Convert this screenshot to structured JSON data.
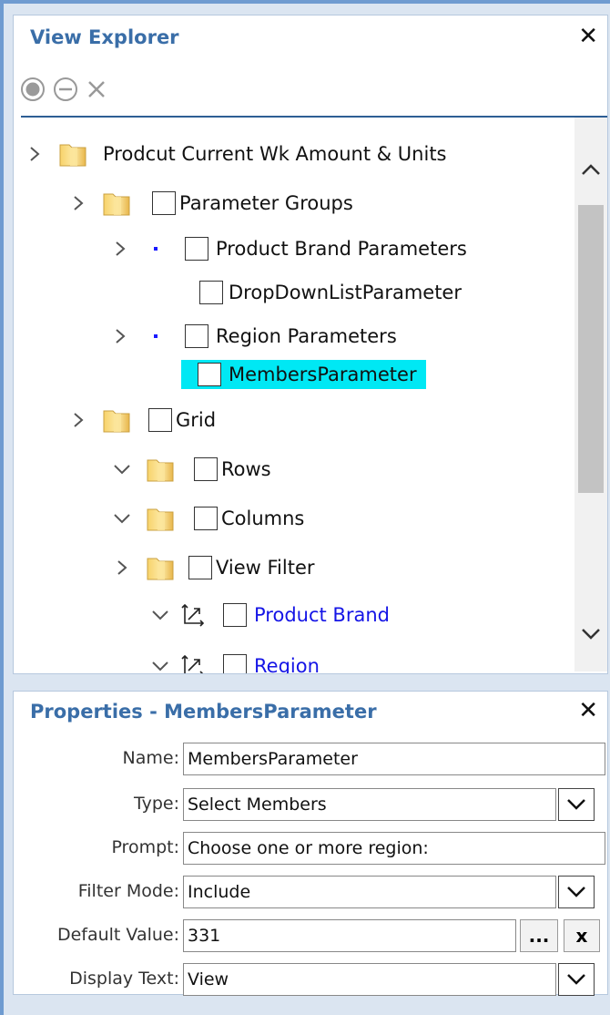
{
  "explorer": {
    "title": "View Explorer",
    "close_icon": "✕"
  },
  "tree": {
    "root": "Prodcut Current Wk Amount & Units",
    "parameter_groups": "Parameter Groups",
    "product_brand_parameters": "Product Brand Parameters",
    "dropdown_list_parameter": "DropDownListParameter",
    "region_parameters": "Region Parameters",
    "members_parameter": "MembersParameter",
    "grid": "Grid",
    "rows": "Rows",
    "columns": "Columns",
    "view_filter": "View Filter",
    "product_brand": "Product Brand",
    "region": "Region"
  },
  "properties": {
    "title": "Properties - MembersParameter",
    "close_icon": "✕",
    "name_label": "Name:",
    "name_value": "MembersParameter",
    "type_label": "Type:",
    "type_value": "Select Members",
    "prompt_label": "Prompt:",
    "prompt_value": "Choose one or more region:",
    "filter_mode_label": "Filter Mode:",
    "filter_mode_value": "Include",
    "default_value_label": "Default Value:",
    "default_value_value": "331",
    "browse_button": "...",
    "clear_button": "x",
    "display_text_label": "Display Text:",
    "display_text_value": "View"
  },
  "colors": {
    "accent": "#3a6ea8",
    "selection": "#00e8f4",
    "link": "#1515e6"
  }
}
